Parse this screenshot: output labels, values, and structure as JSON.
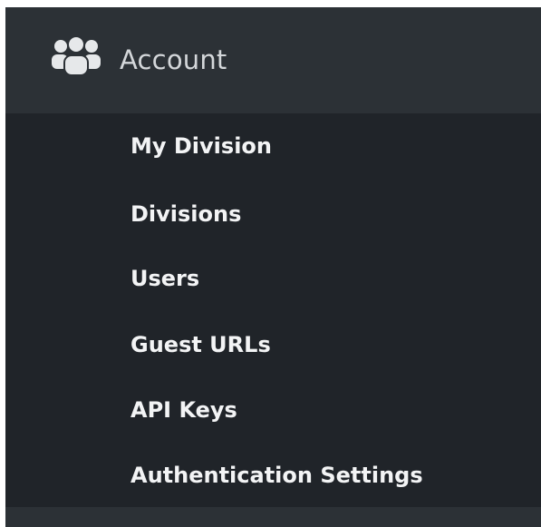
{
  "section": {
    "title": "Account",
    "icon": "users-icon"
  },
  "menu": {
    "items": [
      {
        "label": "My Division"
      },
      {
        "label": "Divisions"
      },
      {
        "label": "Users"
      },
      {
        "label": "Guest URLs"
      },
      {
        "label": "API Keys"
      },
      {
        "label": "Authentication Settings"
      }
    ]
  },
  "colors": {
    "panel_bg": "#202429",
    "header_bg": "#2c3136",
    "header_text": "#d4d7da",
    "item_text": "#f3f4f5",
    "icon": "#e6e8ea"
  }
}
